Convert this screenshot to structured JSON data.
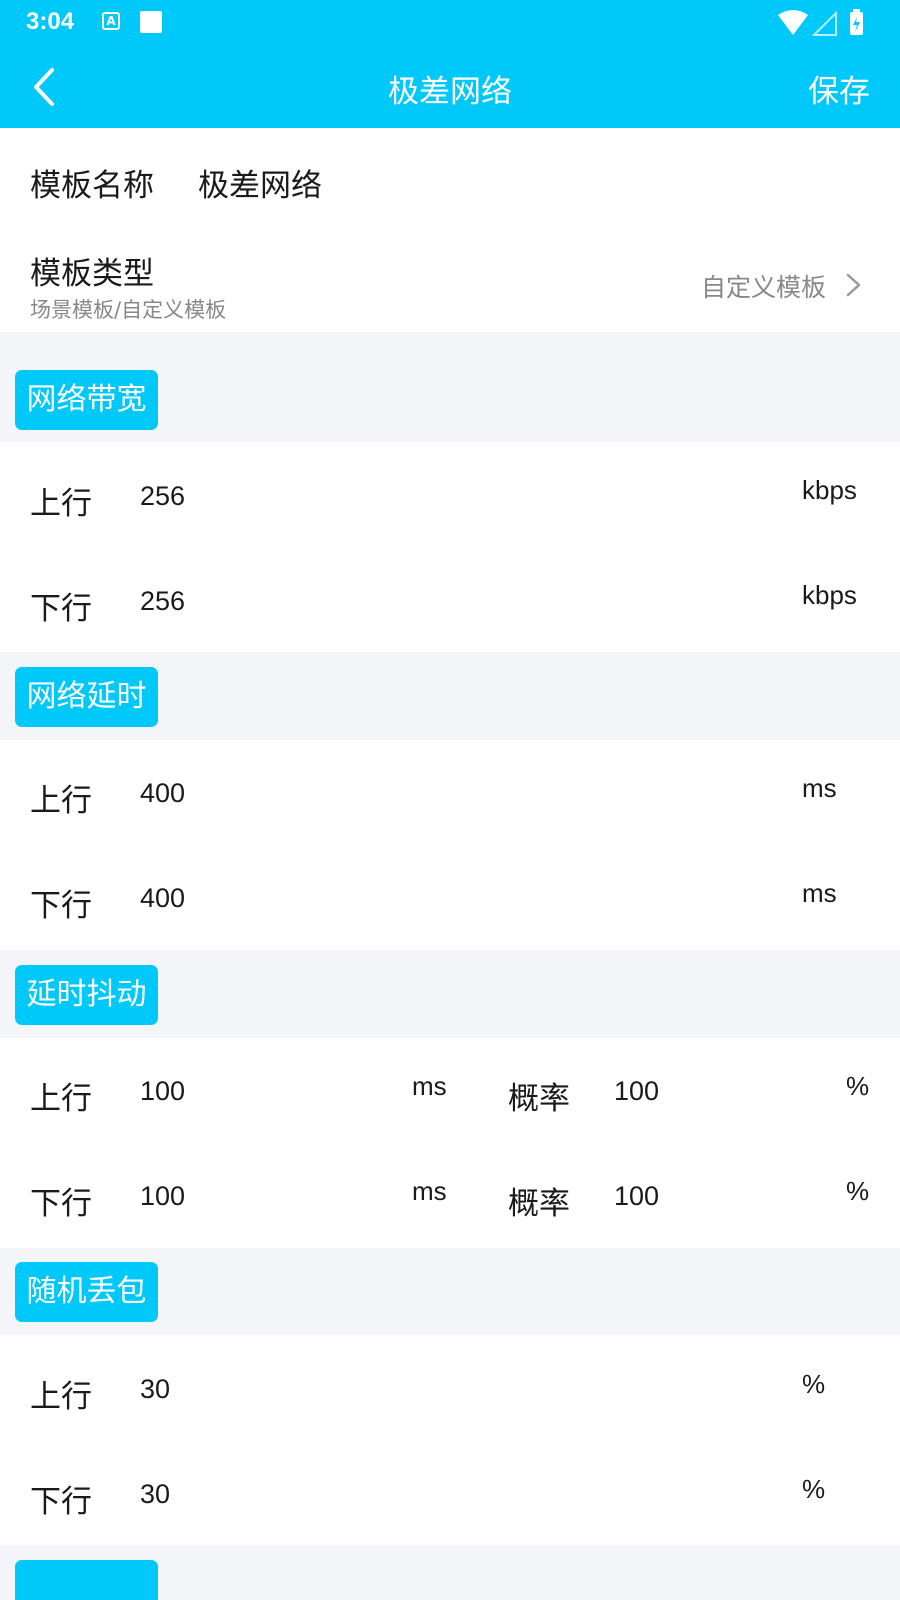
{
  "status": {
    "time": "3:04"
  },
  "appbar": {
    "title": "极差网络",
    "save_label": "保存"
  },
  "template": {
    "name_label": "模板名称",
    "name_value": "极差网络",
    "type_label": "模板类型",
    "type_sub": "场景模板/自定义模板",
    "type_value": "自定义模板"
  },
  "sections": {
    "bandwidth": {
      "title": "网络带宽",
      "up": {
        "label": "上行",
        "value": "256",
        "unit": "kbps"
      },
      "down": {
        "label": "下行",
        "value": "256",
        "unit": "kbps"
      }
    },
    "latency": {
      "title": "网络延时",
      "up": {
        "label": "上行",
        "value": "400",
        "unit": "ms"
      },
      "down": {
        "label": "下行",
        "value": "400",
        "unit": "ms"
      }
    },
    "jitter": {
      "title": "延时抖动",
      "up": {
        "label": "上行",
        "value": "100",
        "unit": "ms",
        "prob_label": "概率",
        "prob_value": "100",
        "prob_unit": "%"
      },
      "down": {
        "label": "下行",
        "value": "100",
        "unit": "ms",
        "prob_label": "概率",
        "prob_value": "100",
        "prob_unit": "%"
      }
    },
    "loss": {
      "title": "随机丢包",
      "up": {
        "label": "上行",
        "value": "30",
        "unit": "%"
      },
      "down": {
        "label": "下行",
        "value": "30",
        "unit": "%"
      }
    }
  },
  "colors": {
    "accent": "#00c8f8",
    "background": "#f4f5f8"
  }
}
